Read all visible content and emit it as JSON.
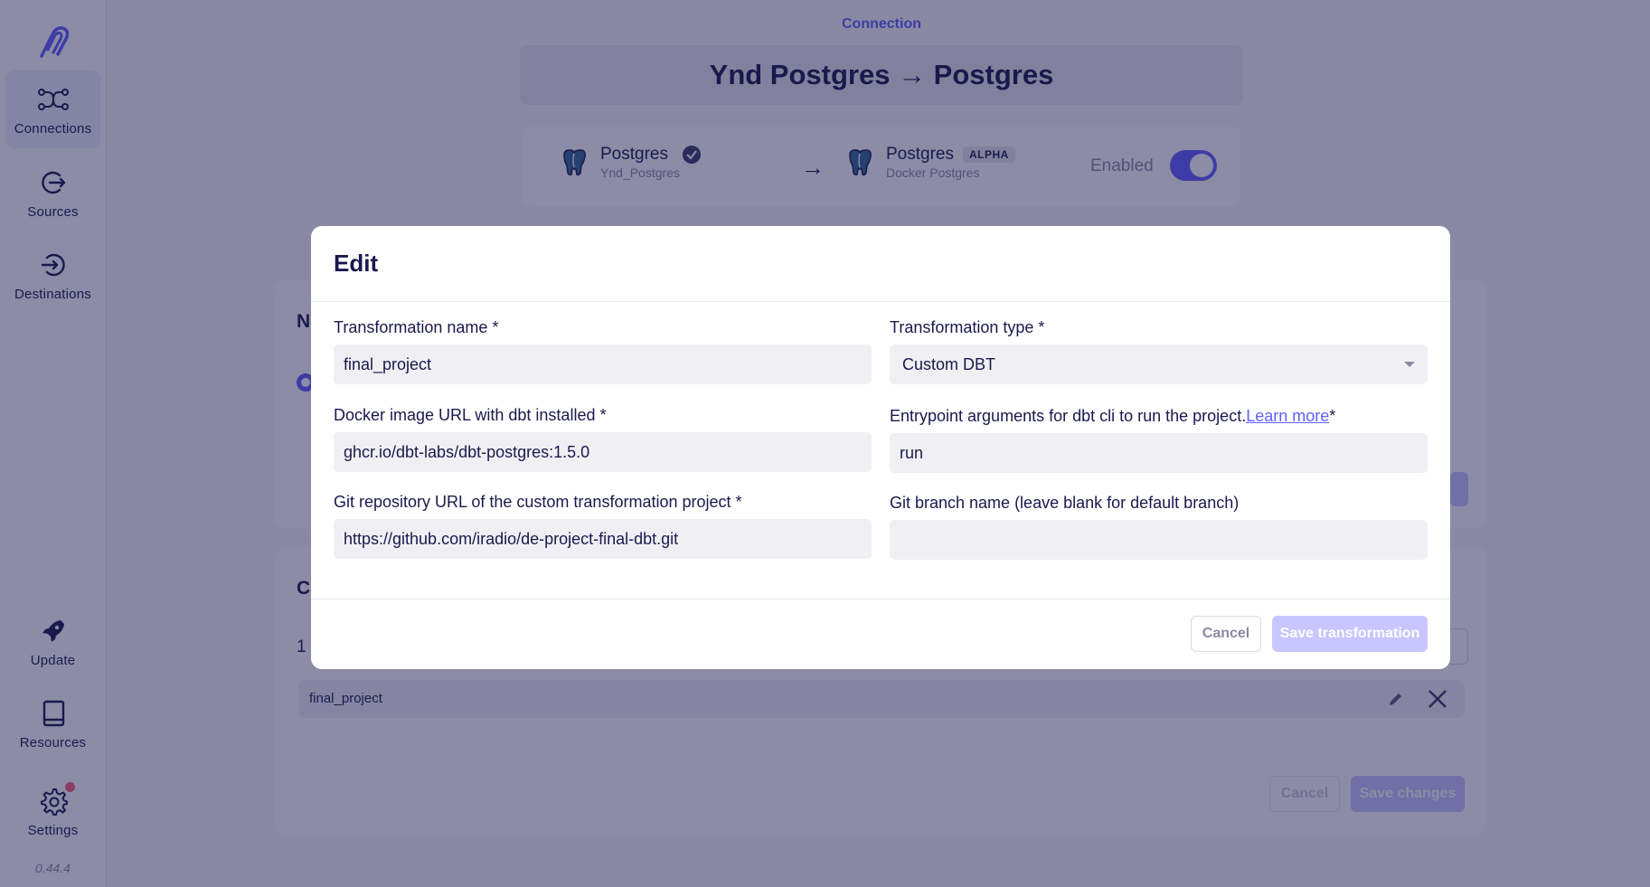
{
  "sidebar": {
    "logo": "airbyte-logo-icon",
    "items": [
      {
        "label": "Connections",
        "icon": "connections-icon",
        "active": true
      },
      {
        "label": "Sources",
        "icon": "source-icon"
      },
      {
        "label": "Destinations",
        "icon": "destination-icon"
      }
    ],
    "bottom_items": [
      {
        "label": "Update",
        "icon": "rocket-icon"
      },
      {
        "label": "Resources",
        "icon": "book-icon"
      },
      {
        "label": "Settings",
        "icon": "gear-icon"
      }
    ],
    "version": "0.44.4"
  },
  "page": {
    "heading": "Connection",
    "title": "Ynd Postgres → Postgres",
    "source": {
      "name": "Postgres",
      "sub": "Ynd_Postgres"
    },
    "destination": {
      "name": "Postgres",
      "badge": "ALPHA",
      "sub": "Docker Postgres"
    },
    "enabled_label": "Enabled",
    "enabled": true,
    "card1_header": "N",
    "card2_header": "C",
    "card2_count": "1",
    "transformation_row": "final_project",
    "cancel_label": "Cancel",
    "save_changes_label": "Save changes"
  },
  "modal": {
    "title": "Edit",
    "fields": {
      "name": {
        "label": "Transformation name *",
        "value": "final_project"
      },
      "type": {
        "label": "Transformation type *",
        "value": "Custom DBT"
      },
      "docker": {
        "label": "Docker image URL with dbt installed *",
        "value": "ghcr.io/dbt-labs/dbt-postgres:1.5.0"
      },
      "entrypoint": {
        "label": "Entrypoint arguments for dbt cli to run the project.",
        "link": "Learn more",
        "required": "*",
        "value": "run"
      },
      "git_url": {
        "label": "Git repository URL of the custom transformation project *",
        "value": "https://github.com/iradio/de-project-final-dbt.git"
      },
      "branch": {
        "label": "Git branch name (leave blank for default branch)",
        "value": ""
      }
    },
    "cancel_label": "Cancel",
    "save_label": "Save transformation"
  },
  "colors": {
    "accent": "#615eff",
    "text": "#1a194d",
    "muted": "#8a8aa3",
    "overlay": "rgba(26,25,77,0.5)",
    "save_disabled": "#c7c6ff"
  }
}
